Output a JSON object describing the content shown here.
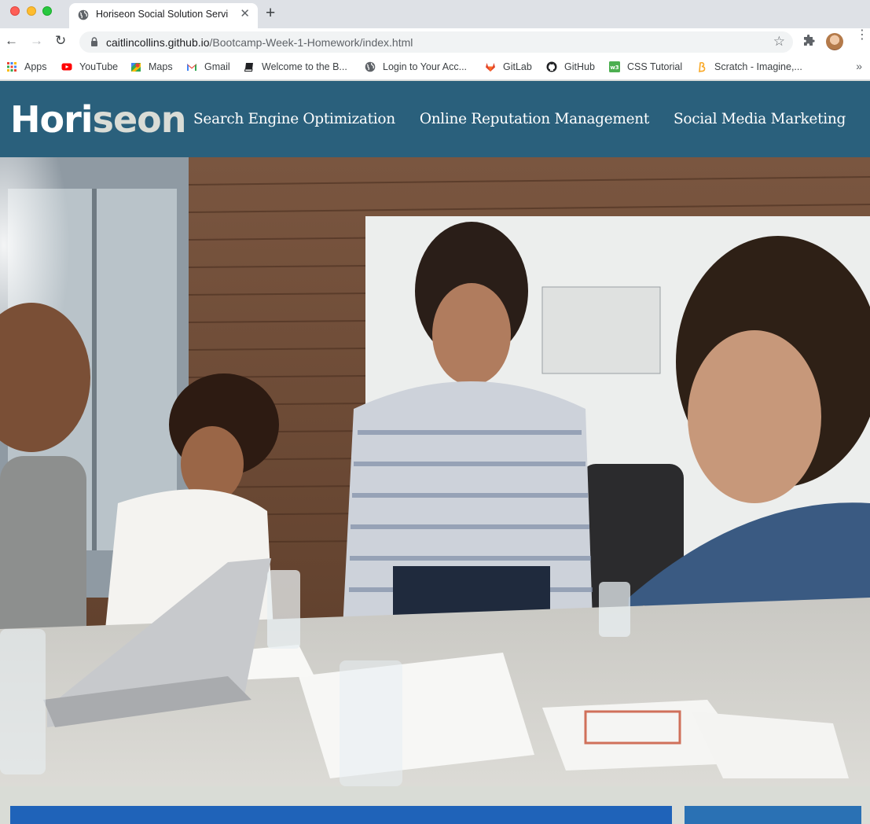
{
  "browser": {
    "tab_title": "Horiseon Social Solution Servi",
    "tab_close": "✕",
    "new_tab": "+",
    "back": "←",
    "forward": "→",
    "reload": "↻",
    "url_host": "caitlincollins.github.io",
    "url_path": "/Bootcamp-Week-1-Homework/index.html",
    "bookmark_star": "☆",
    "menu": "⋮",
    "bookmarks_more": "»",
    "bookmarks": [
      {
        "label": "Apps",
        "icon": "apps-grid-icon"
      },
      {
        "label": "YouTube",
        "icon": "youtube-icon"
      },
      {
        "label": "Maps",
        "icon": "maps-icon"
      },
      {
        "label": "Gmail",
        "icon": "gmail-icon"
      },
      {
        "label": "Welcome to the B...",
        "icon": "book-icon"
      },
      {
        "label": "Login to Your Acc...",
        "icon": "globe-icon"
      },
      {
        "label": "GitLab",
        "icon": "gitlab-icon"
      },
      {
        "label": "GitHub",
        "icon": "github-icon"
      },
      {
        "label": "CSS Tutorial",
        "icon": "w3schools-icon"
      },
      {
        "label": "Scratch - Imagine,...",
        "icon": "scratch-icon"
      }
    ]
  },
  "site": {
    "logo_part1": "Hori",
    "logo_part2": "seon",
    "nav": [
      {
        "label": "Search Engine Optimization"
      },
      {
        "label": "Online Reputation Management"
      },
      {
        "label": "Social Media Marketing"
      }
    ],
    "hero_image": "business-meeting-photo"
  },
  "colors": {
    "header_bg": "#2a607c",
    "page_bg": "#d9dcd6",
    "logo_accent": "#d9dcd6",
    "content_block": "#1f63b9"
  }
}
